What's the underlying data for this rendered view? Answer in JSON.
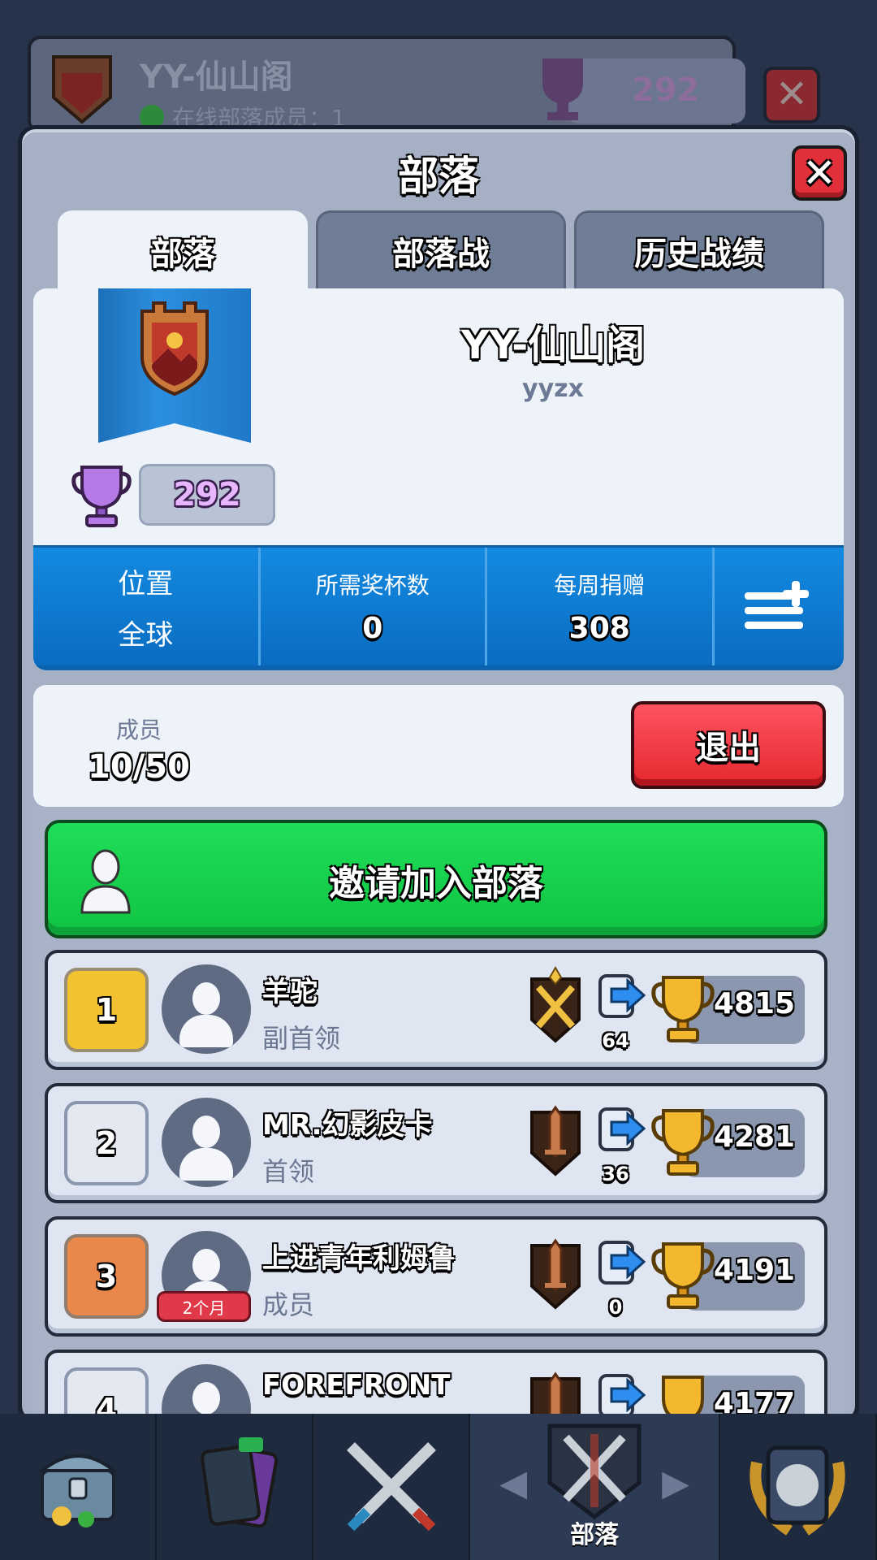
{
  "background_header": {
    "clan_name": "YY-仙山阁",
    "online_text": "在线部落成员：1",
    "trophies": "292"
  },
  "panel": {
    "title": "部落",
    "close_symbol": "✕"
  },
  "tabs": [
    {
      "label": "部落",
      "active": true
    },
    {
      "label": "部落战",
      "active": false
    },
    {
      "label": "历史战绩",
      "active": false
    }
  ],
  "clan": {
    "name": "YY-仙山阁",
    "tag": "yyzx",
    "trophies": "292"
  },
  "stats": {
    "location_label": "位置",
    "location_value": "全球",
    "required_trophies_label": "所需奖杯数",
    "required_trophies_value": "0",
    "weekly_donations_label": "每周捐赠",
    "weekly_donations_value": "308",
    "menu_icon": "list-plus-icon"
  },
  "members_section": {
    "label": "成员",
    "count": "10/50",
    "leave_label": "退出"
  },
  "invite": {
    "label": "邀请加入部落",
    "icon": "person-icon"
  },
  "members": [
    {
      "rank": "1",
      "rank_style": "gold",
      "name": "羊驼",
      "role": "副首领",
      "donations": "64",
      "trophies": "4815",
      "badge": "",
      "arena": "gold-crossed-swords-icon"
    },
    {
      "rank": "2",
      "rank_style": "silver",
      "name": "MR.幻影皮卡",
      "role": "首领",
      "donations": "36",
      "trophies": "4281",
      "badge": "",
      "arena": "bronze-sword-icon"
    },
    {
      "rank": "3",
      "rank_style": "bronze",
      "name": "上进青年利姆鲁",
      "role": "成员",
      "donations": "0",
      "trophies": "4191",
      "badge": "2个月",
      "arena": "bronze-sword-icon"
    },
    {
      "rank": "4",
      "rank_style": "silver",
      "name": "FOREFRONT",
      "role": "",
      "donations": "",
      "trophies": "4177",
      "badge": "",
      "arena": "bronze-sword-icon"
    }
  ],
  "bottom_nav": {
    "items": [
      {
        "name": "shop",
        "icon": "treasure-chest-icon",
        "label": ""
      },
      {
        "name": "cards",
        "icon": "cards-icon",
        "label": ""
      },
      {
        "name": "battle",
        "icon": "crossed-swords-icon",
        "label": ""
      },
      {
        "name": "clan",
        "icon": "clan-shield-icon",
        "label": "部落"
      },
      {
        "name": "events",
        "icon": "laurel-badge-icon",
        "label": ""
      }
    ]
  },
  "colors": {
    "panel": "#a5b0c5",
    "card": "#eef3fa",
    "stats_blue": "#138ae0",
    "invite_green": "#1fdd5a",
    "leave_red": "#e5282f"
  }
}
